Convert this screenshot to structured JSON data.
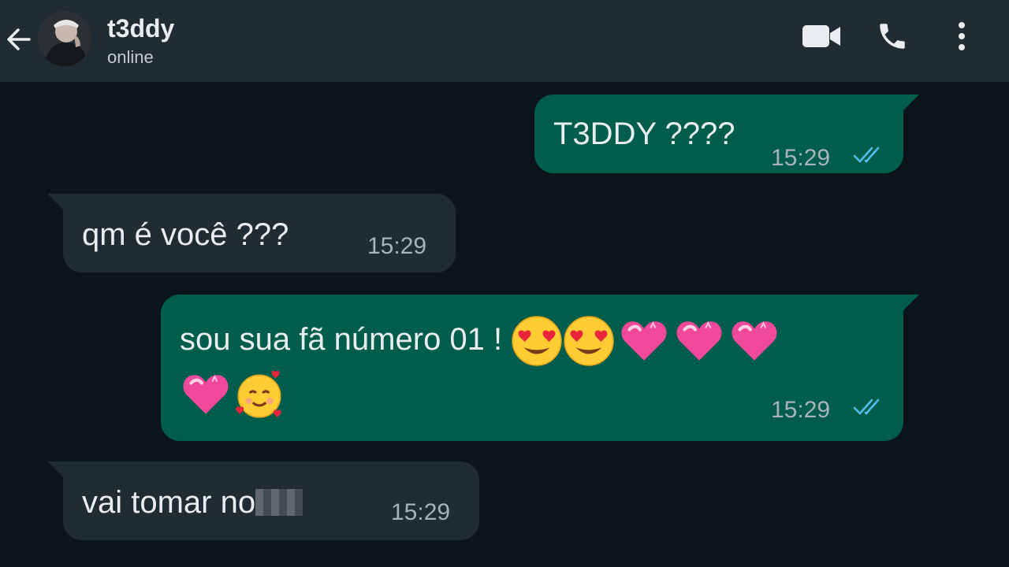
{
  "header": {
    "contact_name": "t3ddy",
    "contact_status": "online",
    "icons": [
      "back-arrow-icon",
      "video-call-icon",
      "phone-icon",
      "more-options-icon"
    ]
  },
  "messages": [
    {
      "direction": "outgoing",
      "text": "T3DDY ????",
      "time": "15:29",
      "status": "read"
    },
    {
      "direction": "incoming",
      "text": "qm é você ???",
      "time": "15:29"
    },
    {
      "direction": "outgoing",
      "text": "sou sua fã número 01 !",
      "emojis": [
        "heart-eyes-emoji",
        "heart-eyes-emoji",
        "pink-heart-emoji",
        "pink-heart-emoji",
        "pink-heart-emoji",
        "pink-heart-emoji",
        "smiling-face-with-hearts-emoji"
      ],
      "time": "15:29",
      "status": "read"
    },
    {
      "direction": "incoming",
      "text": "vai tomar no",
      "censored": true,
      "time": "15:29"
    }
  ],
  "colors": {
    "background": "#0b141a",
    "header": "#1f2c33",
    "outgoing_bubble": "#005c4b",
    "incoming_bubble": "#1f2c33",
    "read_ticks": "#53bdeb"
  }
}
